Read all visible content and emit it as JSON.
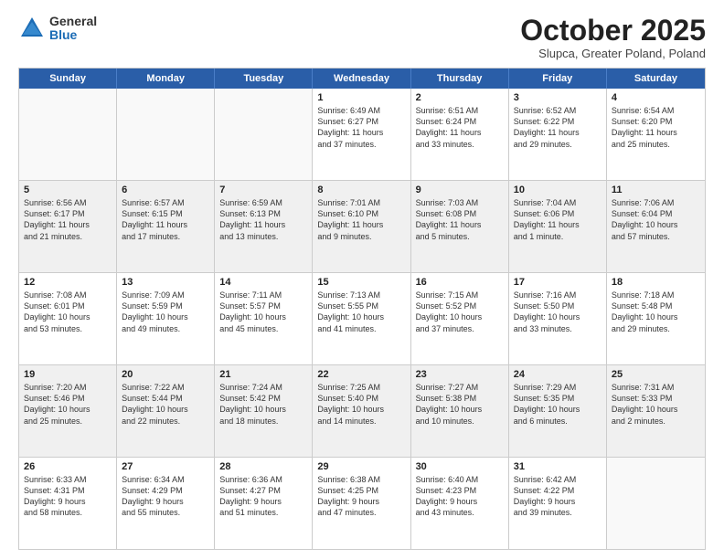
{
  "logo": {
    "general": "General",
    "blue": "Blue"
  },
  "title": "October 2025",
  "subtitle": "Slupca, Greater Poland, Poland",
  "header_days": [
    "Sunday",
    "Monday",
    "Tuesday",
    "Wednesday",
    "Thursday",
    "Friday",
    "Saturday"
  ],
  "weeks": [
    [
      {
        "day": "",
        "info": ""
      },
      {
        "day": "",
        "info": ""
      },
      {
        "day": "",
        "info": ""
      },
      {
        "day": "1",
        "info": "Sunrise: 6:49 AM\nSunset: 6:27 PM\nDaylight: 11 hours\nand 37 minutes."
      },
      {
        "day": "2",
        "info": "Sunrise: 6:51 AM\nSunset: 6:24 PM\nDaylight: 11 hours\nand 33 minutes."
      },
      {
        "day": "3",
        "info": "Sunrise: 6:52 AM\nSunset: 6:22 PM\nDaylight: 11 hours\nand 29 minutes."
      },
      {
        "day": "4",
        "info": "Sunrise: 6:54 AM\nSunset: 6:20 PM\nDaylight: 11 hours\nand 25 minutes."
      }
    ],
    [
      {
        "day": "5",
        "info": "Sunrise: 6:56 AM\nSunset: 6:17 PM\nDaylight: 11 hours\nand 21 minutes."
      },
      {
        "day": "6",
        "info": "Sunrise: 6:57 AM\nSunset: 6:15 PM\nDaylight: 11 hours\nand 17 minutes."
      },
      {
        "day": "7",
        "info": "Sunrise: 6:59 AM\nSunset: 6:13 PM\nDaylight: 11 hours\nand 13 minutes."
      },
      {
        "day": "8",
        "info": "Sunrise: 7:01 AM\nSunset: 6:10 PM\nDaylight: 11 hours\nand 9 minutes."
      },
      {
        "day": "9",
        "info": "Sunrise: 7:03 AM\nSunset: 6:08 PM\nDaylight: 11 hours\nand 5 minutes."
      },
      {
        "day": "10",
        "info": "Sunrise: 7:04 AM\nSunset: 6:06 PM\nDaylight: 11 hours\nand 1 minute."
      },
      {
        "day": "11",
        "info": "Sunrise: 7:06 AM\nSunset: 6:04 PM\nDaylight: 10 hours\nand 57 minutes."
      }
    ],
    [
      {
        "day": "12",
        "info": "Sunrise: 7:08 AM\nSunset: 6:01 PM\nDaylight: 10 hours\nand 53 minutes."
      },
      {
        "day": "13",
        "info": "Sunrise: 7:09 AM\nSunset: 5:59 PM\nDaylight: 10 hours\nand 49 minutes."
      },
      {
        "day": "14",
        "info": "Sunrise: 7:11 AM\nSunset: 5:57 PM\nDaylight: 10 hours\nand 45 minutes."
      },
      {
        "day": "15",
        "info": "Sunrise: 7:13 AM\nSunset: 5:55 PM\nDaylight: 10 hours\nand 41 minutes."
      },
      {
        "day": "16",
        "info": "Sunrise: 7:15 AM\nSunset: 5:52 PM\nDaylight: 10 hours\nand 37 minutes."
      },
      {
        "day": "17",
        "info": "Sunrise: 7:16 AM\nSunset: 5:50 PM\nDaylight: 10 hours\nand 33 minutes."
      },
      {
        "day": "18",
        "info": "Sunrise: 7:18 AM\nSunset: 5:48 PM\nDaylight: 10 hours\nand 29 minutes."
      }
    ],
    [
      {
        "day": "19",
        "info": "Sunrise: 7:20 AM\nSunset: 5:46 PM\nDaylight: 10 hours\nand 25 minutes."
      },
      {
        "day": "20",
        "info": "Sunrise: 7:22 AM\nSunset: 5:44 PM\nDaylight: 10 hours\nand 22 minutes."
      },
      {
        "day": "21",
        "info": "Sunrise: 7:24 AM\nSunset: 5:42 PM\nDaylight: 10 hours\nand 18 minutes."
      },
      {
        "day": "22",
        "info": "Sunrise: 7:25 AM\nSunset: 5:40 PM\nDaylight: 10 hours\nand 14 minutes."
      },
      {
        "day": "23",
        "info": "Sunrise: 7:27 AM\nSunset: 5:38 PM\nDaylight: 10 hours\nand 10 minutes."
      },
      {
        "day": "24",
        "info": "Sunrise: 7:29 AM\nSunset: 5:35 PM\nDaylight: 10 hours\nand 6 minutes."
      },
      {
        "day": "25",
        "info": "Sunrise: 7:31 AM\nSunset: 5:33 PM\nDaylight: 10 hours\nand 2 minutes."
      }
    ],
    [
      {
        "day": "26",
        "info": "Sunrise: 6:33 AM\nSunset: 4:31 PM\nDaylight: 9 hours\nand 58 minutes."
      },
      {
        "day": "27",
        "info": "Sunrise: 6:34 AM\nSunset: 4:29 PM\nDaylight: 9 hours\nand 55 minutes."
      },
      {
        "day": "28",
        "info": "Sunrise: 6:36 AM\nSunset: 4:27 PM\nDaylight: 9 hours\nand 51 minutes."
      },
      {
        "day": "29",
        "info": "Sunrise: 6:38 AM\nSunset: 4:25 PM\nDaylight: 9 hours\nand 47 minutes."
      },
      {
        "day": "30",
        "info": "Sunrise: 6:40 AM\nSunset: 4:23 PM\nDaylight: 9 hours\nand 43 minutes."
      },
      {
        "day": "31",
        "info": "Sunrise: 6:42 AM\nSunset: 4:22 PM\nDaylight: 9 hours\nand 39 minutes."
      },
      {
        "day": "",
        "info": ""
      }
    ]
  ]
}
